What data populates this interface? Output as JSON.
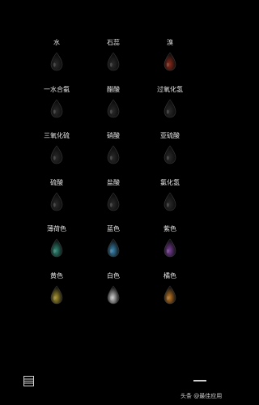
{
  "items": [
    {
      "label": "水",
      "color": "#2a2a2a",
      "icon": "droplet-icon"
    },
    {
      "label": "石蕊",
      "color": "#2a2a2a",
      "icon": "droplet-icon"
    },
    {
      "label": "溴",
      "color": "#8a2a1a",
      "icon": "droplet-icon"
    },
    {
      "label": "一水合氨",
      "color": "#2a2a2a",
      "icon": "droplet-icon"
    },
    {
      "label": "醋酸",
      "color": "#2a2a2a",
      "icon": "droplet-icon"
    },
    {
      "label": "过氧化氢",
      "color": "#2a2a2a",
      "icon": "droplet-icon"
    },
    {
      "label": "三氧化硫",
      "color": "#2a2a2a",
      "icon": "droplet-icon"
    },
    {
      "label": "硝酸",
      "color": "#2a2a2a",
      "icon": "droplet-icon"
    },
    {
      "label": "亚硫酸",
      "color": "#2a2a2a",
      "icon": "droplet-icon"
    },
    {
      "label": "硫酸",
      "color": "#2a2a2a",
      "icon": "droplet-icon"
    },
    {
      "label": "盐酸",
      "color": "#2a2a2a",
      "icon": "droplet-icon"
    },
    {
      "label": "氯化氢",
      "color": "#2a2a2a",
      "icon": "droplet-icon"
    },
    {
      "label": "薄荷色",
      "color": "#2f8c78",
      "icon": "droplet-icon"
    },
    {
      "label": "蓝色",
      "color": "#3a86b0",
      "icon": "droplet-icon"
    },
    {
      "label": "紫色",
      "color": "#7a3f9a",
      "icon": "droplet-icon"
    },
    {
      "label": "黄色",
      "color": "#a8962e",
      "icon": "droplet-icon"
    },
    {
      "label": "白色",
      "color": "#cfcfcf",
      "icon": "droplet-icon"
    },
    {
      "label": "橘色",
      "color": "#c07a28",
      "icon": "droplet-icon"
    }
  ],
  "toolbar": {
    "menu_icon": "list-icon",
    "minimize_icon": "dash-icon"
  },
  "watermark": "头条 @最佳应用"
}
